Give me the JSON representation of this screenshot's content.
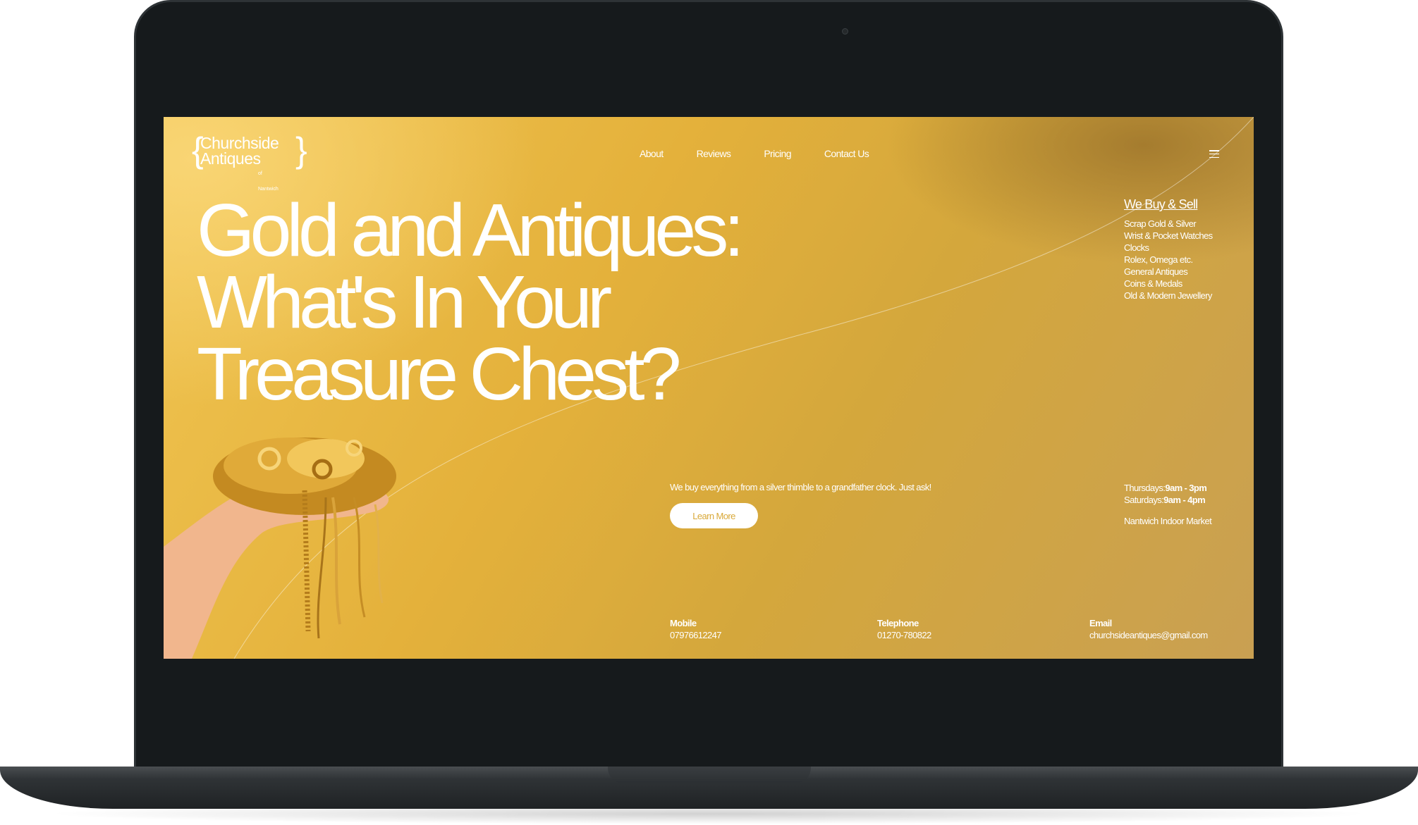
{
  "logo": {
    "line1": "Churchside",
    "line2": "Antiques",
    "sub": "of Nantwich"
  },
  "nav": [
    "About",
    "Reviews",
    "Pricing",
    "Contact Us"
  ],
  "headline": [
    "Gold and Antiques:",
    "What's In Your",
    "Treasure Chest?"
  ],
  "buy_sell": {
    "title": "We Buy & Sell",
    "items": [
      "Scrap Gold & Silver",
      "Wrist & Pocket Watches",
      "Clocks",
      "Rolex, Omega etc.",
      "General Antiques",
      "Coins & Medals",
      "Old & Modern Jewellery"
    ]
  },
  "tagline": "We buy everything from a silver thimble to a grandfather clock. Just ask!",
  "learn_more": "Learn More",
  "hours": {
    "thu_label": "Thursdays:",
    "thu_time": "9am - 3pm",
    "sat_label": "Saturdays:",
    "sat_time": "9am - 4pm",
    "market": "Nantwich Indoor Market"
  },
  "contact": {
    "mobile_label": "Mobile",
    "mobile": "07976612247",
    "tel_label": "Telephone",
    "tel": "01270-780822",
    "email_label": "Email",
    "email": "churchsideantiques@gmail.com"
  },
  "colors": {
    "gold": "#e4b13b",
    "bezel": "#161a1c"
  }
}
